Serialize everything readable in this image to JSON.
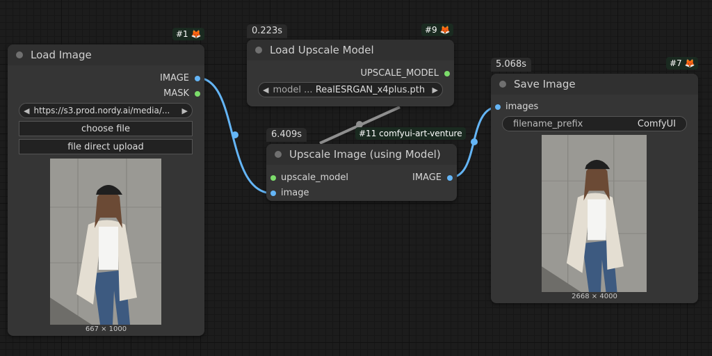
{
  "links_colors": {
    "image": "#64b5f6",
    "model": "#8f8f8f"
  },
  "node1": {
    "id_tag": "#1 🦊",
    "title": "Load Image",
    "output_image": "IMAGE",
    "output_mask": "MASK",
    "url_value": "https://s3.prod.nordy.ai/media/...",
    "choose_file": "choose file",
    "direct_upload": "file direct upload",
    "preview_size": "667 × 1000"
  },
  "node9": {
    "time": "0.223s",
    "id_tag": "#9 🦊",
    "title": "Load Upscale Model",
    "output": "UPSCALE_MODEL",
    "model_label": "model ...",
    "model_value": "RealESRGAN_x4plus.pth"
  },
  "node11": {
    "time": "6.409s",
    "id_tag": "#11 comfyui-art-venture",
    "title": "Upscale Image (using Model)",
    "input_model": "upscale_model",
    "input_image": "image",
    "output_image": "IMAGE"
  },
  "node7": {
    "time": "5.068s",
    "id_tag": "#7 🦊",
    "title": "Save Image",
    "input_images": "images",
    "prefix_label": "filename_prefix",
    "prefix_value": "ComfyUI",
    "preview_size": "2668 × 4000"
  }
}
